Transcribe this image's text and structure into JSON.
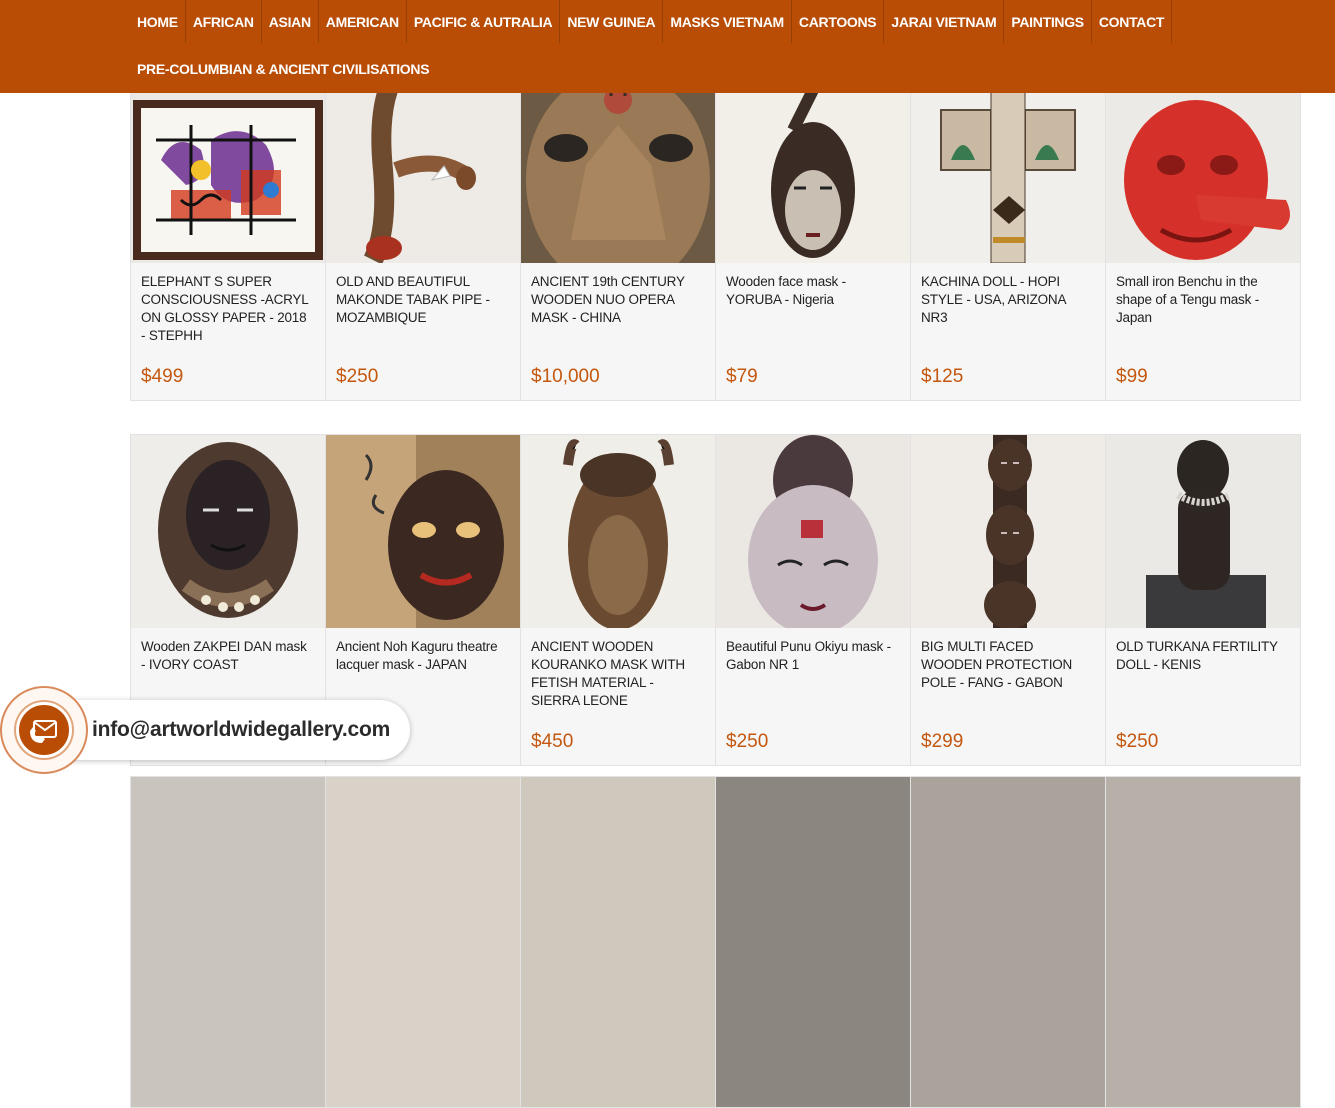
{
  "nav": {
    "row1": [
      "HOME",
      "AFRICAN",
      "ASIAN",
      "AMERICAN",
      "PACIFIC & AUTRALIA",
      "NEW GUINEA",
      "MASKS VIETNAM",
      "CARTOONS",
      "JARAI VIETNAM",
      "PAINTINGS",
      "CONTACT"
    ],
    "row2": [
      "PRE-COLUMBIAN & ANCIENT CIVILISATIONS"
    ]
  },
  "products": {
    "row1": [
      {
        "title": "ELEPHANT S SUPER CONSCIOUSNESS -ACRYL ON GLOSSY PAPER - 2018 - STEPHH",
        "price": "$499",
        "image": "painting-image"
      },
      {
        "title": "OLD AND BEAUTIFUL MAKONDE TABAK PIPE - MOZAMBIQUE",
        "price": "$250",
        "image": "pipe-image"
      },
      {
        "title": "ANCIENT 19th CENTURY WOODEN NUO OPERA MASK - CHINA",
        "price": "$10,000",
        "image": "nuo-mask-image"
      },
      {
        "title": "Wooden face mask - YORUBA - Nigeria",
        "price": "$79",
        "image": "yoruba-mask-image"
      },
      {
        "title": "KACHINA DOLL - HOPI STYLE - USA, ARIZONA NR3",
        "price": "$125",
        "image": "kachina-doll-image"
      },
      {
        "title": "Small iron Benchu in the shape of a Tengu mask - Japan",
        "price": "$99",
        "image": "tengu-mask-image"
      }
    ],
    "row2": [
      {
        "title": "Wooden ZAKPEI DAN mask - IVORY COAST",
        "price": "",
        "image": "dan-mask-image"
      },
      {
        "title": "Ancient Noh Kaguru theatre lacquer mask - JAPAN",
        "price": "",
        "image": "noh-mask-image"
      },
      {
        "title": "ANCIENT WOODEN KOURANKO MASK WITH FETISH MATERIAL - SIERRA LEONE",
        "price": "$450",
        "image": "kouranko-mask-image"
      },
      {
        "title": "Beautiful Punu Okiyu mask - Gabon NR 1",
        "price": "$250",
        "image": "punu-mask-image"
      },
      {
        "title": "BIG MULTI FACED WOODEN PROTECTION POLE - FANG - GABON",
        "price": "$299",
        "image": "fang-pole-image"
      },
      {
        "title": "OLD TURKANA FERTILITY DOLL - KENIS",
        "price": "$250",
        "image": "turkana-doll-image"
      }
    ]
  },
  "contact": {
    "email": "info@artworldwidegallery.com",
    "icon": "phone-mail-icon"
  },
  "colors": {
    "nav_bg": "#b94d05",
    "price": "#c4570f",
    "card_body_bg": "#f6f6f6"
  }
}
